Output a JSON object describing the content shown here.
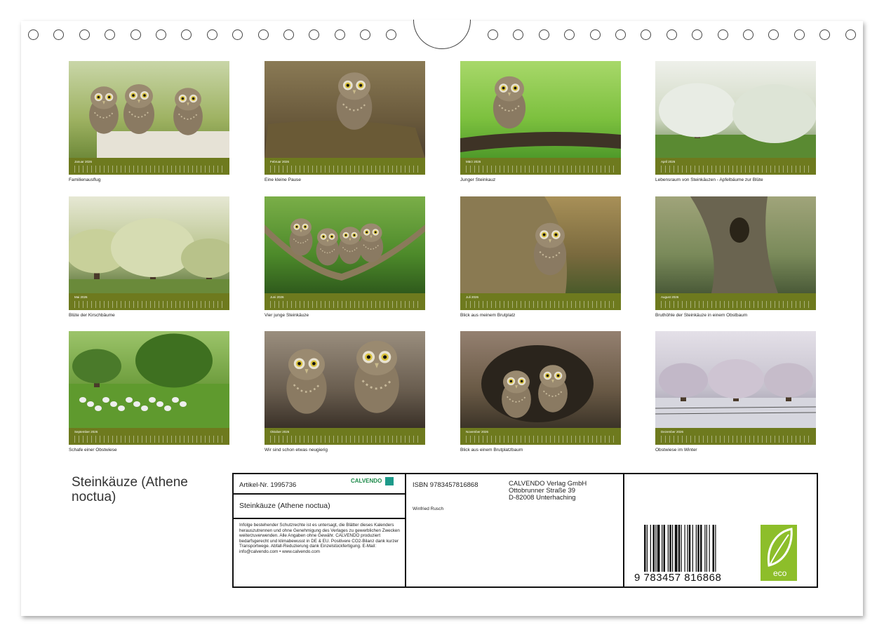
{
  "months": [
    {
      "name": "Januar 2026",
      "caption": "Familienausflug",
      "palette": [
        "#6f8a3a",
        "#9eb262",
        "#c9d6a8"
      ],
      "subject": "owls-on-fence"
    },
    {
      "name": "Februar 2026",
      "caption": "Eine kleine Pause",
      "palette": [
        "#4c4030",
        "#6a5a3c",
        "#8a7a55"
      ],
      "subject": "owl-on-stump"
    },
    {
      "name": "März 2026",
      "caption": "Junger Steinkauz",
      "palette": [
        "#4f9a2a",
        "#7cc03e",
        "#a8d86a"
      ],
      "subject": "owl-on-branch"
    },
    {
      "name": "April 2026",
      "caption": "Lebensraum von Steinkäuzen - Apfelbäume zur Blüte",
      "palette": [
        "#5a7a3a",
        "#cfd8c2",
        "#eef0ea"
      ],
      "subject": "blossom-trees"
    },
    {
      "name": "Mai 2026",
      "caption": "Blüte der Kirschbäume",
      "palette": [
        "#56703a",
        "#b7c28a",
        "#e6e8d4"
      ],
      "subject": "cherry-trees"
    },
    {
      "name": "Juni 2026",
      "caption": "Vier junge Steinkäuze",
      "palette": [
        "#2f5a1c",
        "#4d8a2a",
        "#7aae48"
      ],
      "subject": "four-owls"
    },
    {
      "name": "Juli 2026",
      "caption": "Blick aus meinem Brutplatz",
      "palette": [
        "#4a5a2a",
        "#7a6a3e",
        "#a89058"
      ],
      "subject": "owl-in-hole"
    },
    {
      "name": "August 2026",
      "caption": "Bruthöhle der Steinkäuze in einem Obstbaum",
      "palette": [
        "#4a5a38",
        "#7a8a5a",
        "#a0a47a"
      ],
      "subject": "tree-hollow"
    },
    {
      "name": "September 2026",
      "caption": "Schafe einer Obstwiese",
      "palette": [
        "#3f6a22",
        "#6a9a3a",
        "#9cc46a"
      ],
      "subject": "sheep"
    },
    {
      "name": "Oktober 2026",
      "caption": "Wir sind schon etwas neugierig",
      "palette": [
        "#3a3128",
        "#6a5e50",
        "#9a8e7e"
      ],
      "subject": "two-owls"
    },
    {
      "name": "November 2026",
      "caption": "Blick aus einem Brutplatzbaum",
      "palette": [
        "#3c3428",
        "#6a5a46",
        "#948070"
      ],
      "subject": "owls-in-trunk"
    },
    {
      "name": "Dezember 2026",
      "caption": "Obstwiese im Winter",
      "palette": [
        "#8a8a98",
        "#c4c0cc",
        "#e4e0e8"
      ],
      "subject": "frost-trees"
    }
  ],
  "calendar_title": "Steinkäuze (Athene noctua)",
  "info": {
    "article": "Artikel-Nr. 1995736",
    "brand": "CALVENDO",
    "product_title": "Steinkäuze (Athene noctua)",
    "legal": "Infolge bestehender Schutzrechte ist es untersagt, die Blätter dieses Kalenders herauszutrennen und ohne Genehmigung des Verlages zu gewerblichen Zwecken weiterzuverwenden. Alle Angaben ohne Gewähr. CALVENDO produziert bedarfsgerecht und klimabewusst in DE & EU. Positivere CO2-Bilanz dank kurzer Transportwege. Abfall-Reduzierung dank Einzelstückfertigung. E-Mail: info@calvendo.com • www.calvendo.com",
    "isbn": "ISBN 9783457816868",
    "publisher": [
      "CALVENDO Verlag GmbH",
      "Ottobrunner Straße 39",
      "D-82008 Unterhaching"
    ],
    "author": "Winfried Rusch",
    "barcode_number": "9 783457 816868",
    "eco_label": "eco"
  }
}
